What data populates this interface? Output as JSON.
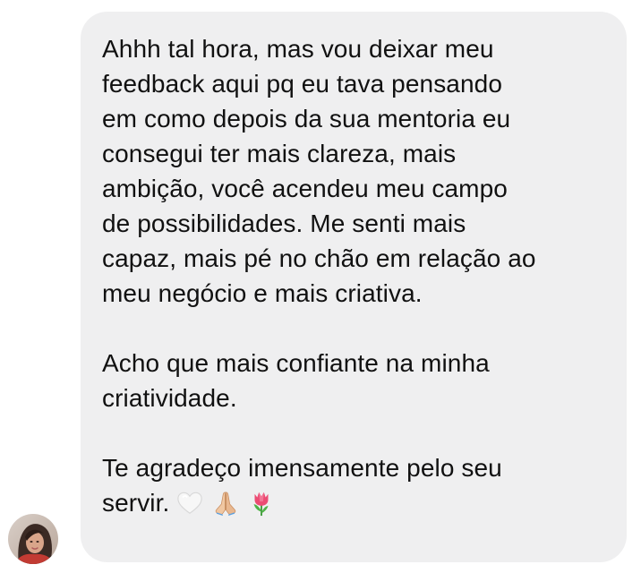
{
  "message": {
    "paragraph_1": "Ahhh tal hora, mas vou deixar meu\nfeedback aqui pq eu tava pensando\nem como depois da sua mentoria eu\nconsegui ter mais clareza, mais\nambição, você acendeu meu campo\nde possibilidades. Me senti mais\ncapaz, mais pé no chão em relação ao\nmeu negócio e mais criativa.",
    "paragraph_2": "Acho que mais confiante na minha\ncriatividade.",
    "paragraph_3": "Te agradeço imensamente pelo seu\nservir.",
    "emojis": [
      "white-heart",
      "folded-hands",
      "tulip"
    ]
  },
  "colors": {
    "bubble_background": "#efeff0",
    "text": "#111111",
    "page_background": "#ffffff"
  },
  "avatar": {
    "icon": "user-avatar-photo"
  }
}
